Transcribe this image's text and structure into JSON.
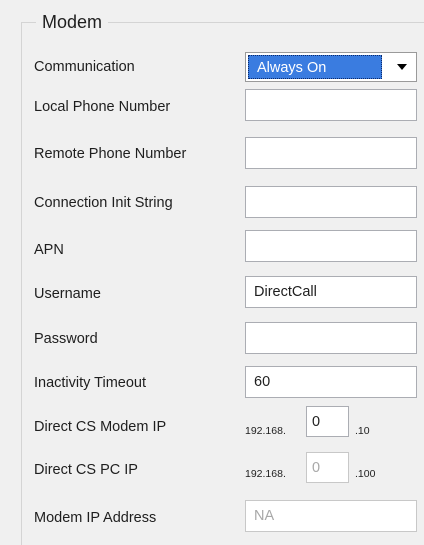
{
  "group": {
    "title": "Modem"
  },
  "communication": {
    "label": "Communication",
    "value": "Always On"
  },
  "local_phone": {
    "label": "Local Phone Number",
    "value": ""
  },
  "remote_phone": {
    "label": "Remote Phone Number",
    "value": ""
  },
  "init_string": {
    "label": "Connection Init String",
    "value": ""
  },
  "apn": {
    "label": "APN",
    "value": ""
  },
  "username": {
    "label": "Username",
    "value": "DirectCall"
  },
  "password": {
    "label": "Password",
    "value": ""
  },
  "inactivity_timeout": {
    "label": "Inactivity Timeout",
    "value": "60"
  },
  "cs_modem_ip": {
    "label": "Direct CS Modem IP",
    "prefix": "192.168.",
    "octet": "0",
    "suffix": ".10"
  },
  "cs_pc_ip": {
    "label": "Direct CS PC IP",
    "prefix": "192.168.",
    "octet": "0",
    "suffix": ".100"
  },
  "modem_ip": {
    "label": "Modem IP Address",
    "value": "NA"
  },
  "colors": {
    "selection": "#3a7ce0",
    "panel_bg": "#f0f0f0",
    "border": "#abadb3",
    "disabled_text": "#a8a8a8"
  },
  "icons": {
    "dropdown": "chevron-down-icon"
  }
}
